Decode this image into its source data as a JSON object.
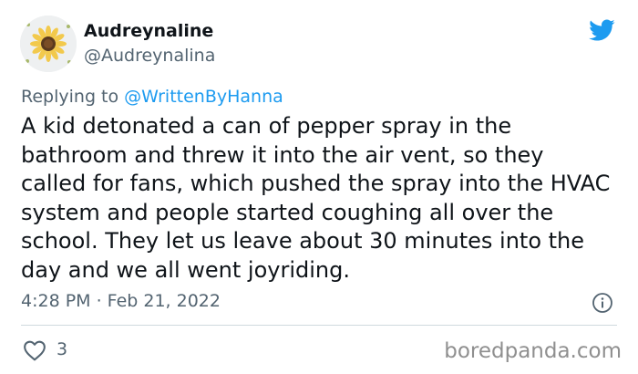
{
  "author": {
    "display_name": "Audreynaline",
    "handle": "@Audreynalina"
  },
  "reply": {
    "prefix": "Replying to",
    "mention": "@WrittenByHanna"
  },
  "tweet": {
    "text": "A kid detonated a can of pepper spray in the bathroom and threw it into the air vent, so they called for fans, which pushed the spray into the HVAC system and people started coughing all over the school. They let us leave about 30 minutes into the day and we all went joyriding.",
    "timestamp": "4:28 PM · Feb 21, 2022"
  },
  "engagement": {
    "likes": "3"
  },
  "watermark": "boredpanda.com",
  "icons": {
    "platform": "twitter-bird-icon",
    "info": "info-icon",
    "like": "heart-icon",
    "avatar": "sunflower-avatar"
  },
  "colors": {
    "text_primary": "#0f1419",
    "text_secondary": "#536471",
    "link": "#1d9bf0",
    "twitter_blue": "#1d9bf0",
    "divider": "#cfd9de",
    "watermark": "#8f8f8f"
  }
}
